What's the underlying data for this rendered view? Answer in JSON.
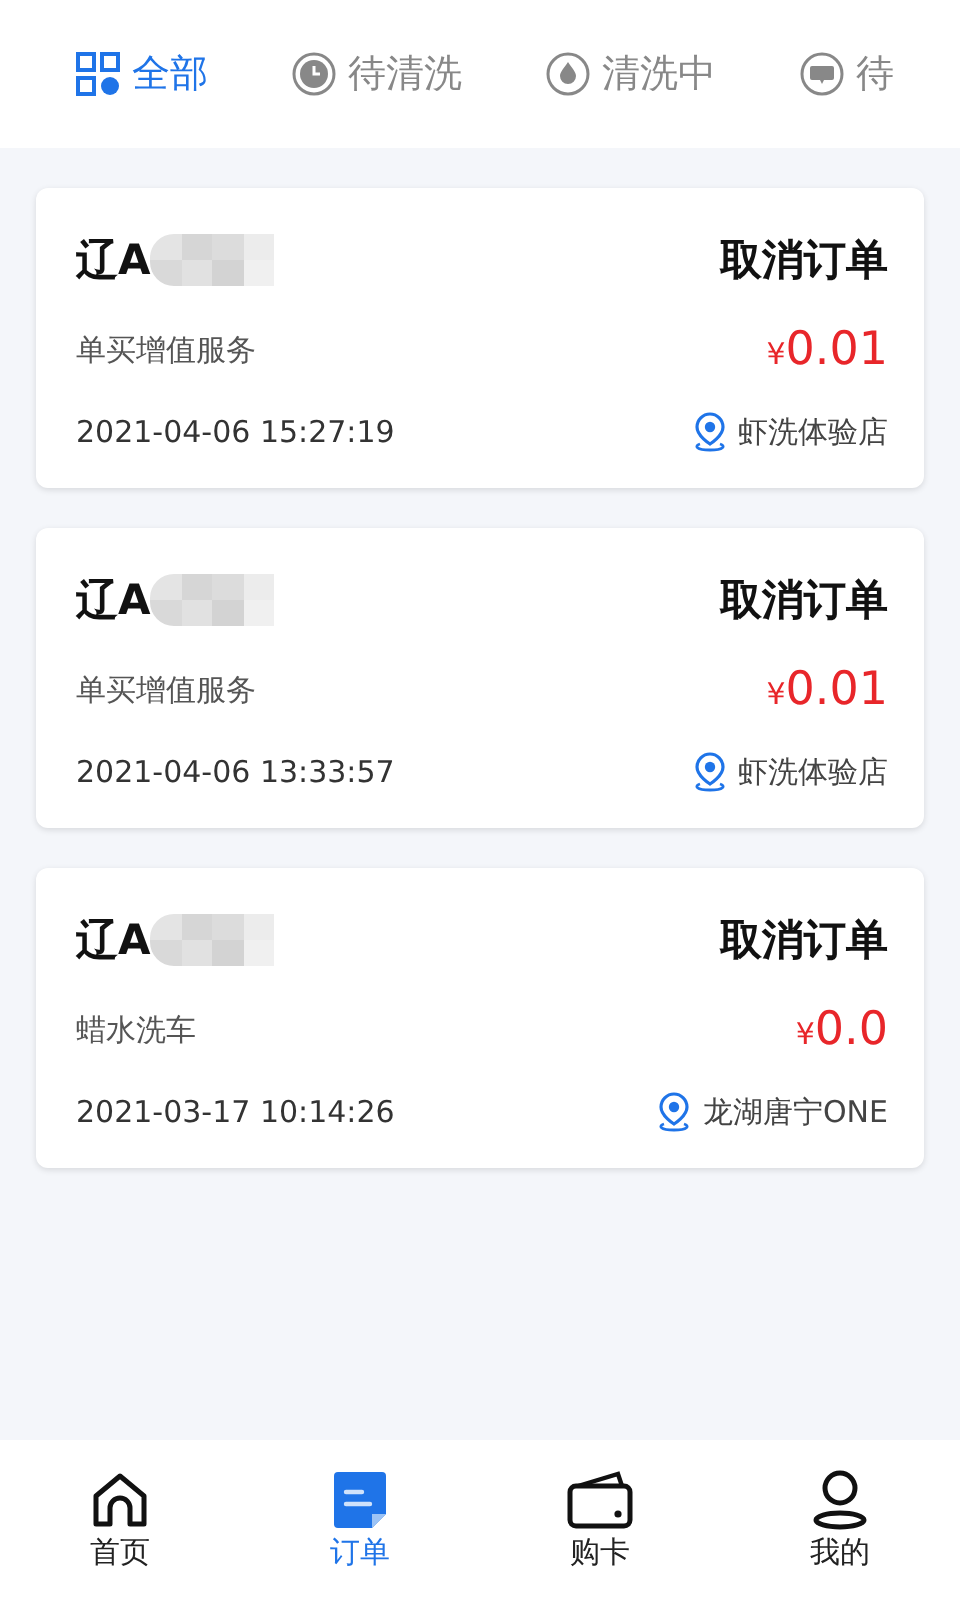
{
  "tabs": [
    {
      "label": "全部",
      "kind": "grid",
      "selected": true
    },
    {
      "label": "待清洗",
      "kind": "clock",
      "selected": false
    },
    {
      "label": "清洗中",
      "kind": "drop",
      "selected": false
    },
    {
      "label": "待",
      "kind": "chat",
      "selected": false
    }
  ],
  "orders": [
    {
      "plate": "辽A",
      "action": "取消订单",
      "service": "单买增值服务",
      "price_symbol": "¥",
      "price": "0.01",
      "time": "2021-04-06 15:27:19",
      "store": "虾洗体验店"
    },
    {
      "plate": "辽A",
      "action": "取消订单",
      "service": "单买增值服务",
      "price_symbol": "¥",
      "price": "0.01",
      "time": "2021-04-06 13:33:57",
      "store": "虾洗体验店"
    },
    {
      "plate": "辽A",
      "action": "取消订单",
      "service": "蜡水洗车",
      "price_symbol": "¥",
      "price": "0.0",
      "time": "2021-03-17 10:14:26",
      "store": "龙湖唐宁ONE"
    }
  ],
  "nav": [
    {
      "label": "首页",
      "kind": "home",
      "selected": false
    },
    {
      "label": "订单",
      "kind": "orders",
      "selected": true
    },
    {
      "label": "购卡",
      "kind": "wallet",
      "selected": false
    },
    {
      "label": "我的",
      "kind": "user",
      "selected": false
    }
  ]
}
